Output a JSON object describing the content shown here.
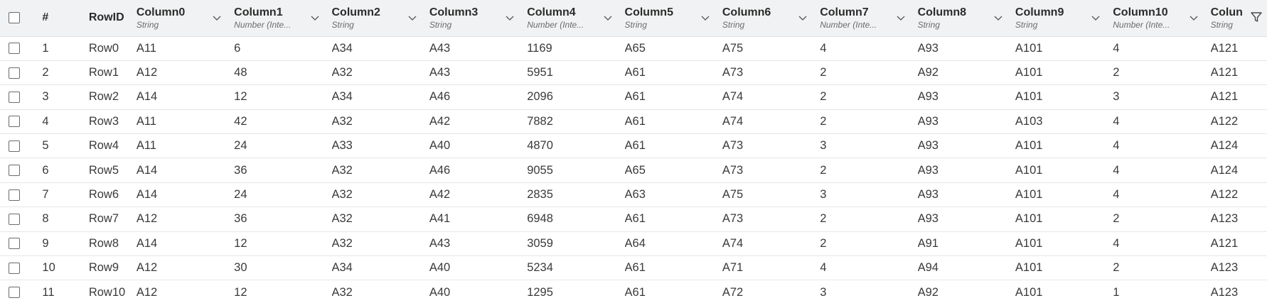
{
  "table": {
    "index_header": "#",
    "rowid_header": "RowID",
    "columns": [
      {
        "name": "Column0",
        "type": "String"
      },
      {
        "name": "Column1",
        "type": "Number (Inte..."
      },
      {
        "name": "Column2",
        "type": "String"
      },
      {
        "name": "Column3",
        "type": "String"
      },
      {
        "name": "Column4",
        "type": "Number (Inte..."
      },
      {
        "name": "Column5",
        "type": "String"
      },
      {
        "name": "Column6",
        "type": "String"
      },
      {
        "name": "Column7",
        "type": "Number (Inte..."
      },
      {
        "name": "Column8",
        "type": "String"
      },
      {
        "name": "Column9",
        "type": "String"
      },
      {
        "name": "Column10",
        "type": "Number (Inte..."
      },
      {
        "name": "Colun",
        "type": "String"
      }
    ],
    "rows": [
      {
        "index": "1",
        "rowid": "Row0",
        "cells": [
          "A11",
          "6",
          "A34",
          "A43",
          "1169",
          "A65",
          "A75",
          "4",
          "A93",
          "A101",
          "4",
          "A121"
        ]
      },
      {
        "index": "2",
        "rowid": "Row1",
        "cells": [
          "A12",
          "48",
          "A32",
          "A43",
          "5951",
          "A61",
          "A73",
          "2",
          "A92",
          "A101",
          "2",
          "A121"
        ]
      },
      {
        "index": "3",
        "rowid": "Row2",
        "cells": [
          "A14",
          "12",
          "A34",
          "A46",
          "2096",
          "A61",
          "A74",
          "2",
          "A93",
          "A101",
          "3",
          "A121"
        ]
      },
      {
        "index": "4",
        "rowid": "Row3",
        "cells": [
          "A11",
          "42",
          "A32",
          "A42",
          "7882",
          "A61",
          "A74",
          "2",
          "A93",
          "A103",
          "4",
          "A122"
        ]
      },
      {
        "index": "5",
        "rowid": "Row4",
        "cells": [
          "A11",
          "24",
          "A33",
          "A40",
          "4870",
          "A61",
          "A73",
          "3",
          "A93",
          "A101",
          "4",
          "A124"
        ]
      },
      {
        "index": "6",
        "rowid": "Row5",
        "cells": [
          "A14",
          "36",
          "A32",
          "A46",
          "9055",
          "A65",
          "A73",
          "2",
          "A93",
          "A101",
          "4",
          "A124"
        ]
      },
      {
        "index": "7",
        "rowid": "Row6",
        "cells": [
          "A14",
          "24",
          "A32",
          "A42",
          "2835",
          "A63",
          "A75",
          "3",
          "A93",
          "A101",
          "4",
          "A122"
        ]
      },
      {
        "index": "8",
        "rowid": "Row7",
        "cells": [
          "A12",
          "36",
          "A32",
          "A41",
          "6948",
          "A61",
          "A73",
          "2",
          "A93",
          "A101",
          "2",
          "A123"
        ]
      },
      {
        "index": "9",
        "rowid": "Row8",
        "cells": [
          "A14",
          "12",
          "A32",
          "A43",
          "3059",
          "A64",
          "A74",
          "2",
          "A91",
          "A101",
          "4",
          "A121"
        ]
      },
      {
        "index": "10",
        "rowid": "Row9",
        "cells": [
          "A12",
          "30",
          "A34",
          "A40",
          "5234",
          "A61",
          "A71",
          "4",
          "A94",
          "A101",
          "2",
          "A123"
        ]
      },
      {
        "index": "11",
        "rowid": "Row10",
        "cells": [
          "A12",
          "12",
          "A32",
          "A40",
          "1295",
          "A61",
          "A72",
          "3",
          "A92",
          "A101",
          "1",
          "A123"
        ]
      }
    ]
  },
  "icons": {
    "sort": "chevron-down-icon",
    "filter": "filter-icon",
    "select": "checkbox"
  },
  "colors": {
    "header_bg": "#f1f2f3",
    "row_border": "#e6e6e6",
    "text": "#3a3a3a"
  }
}
